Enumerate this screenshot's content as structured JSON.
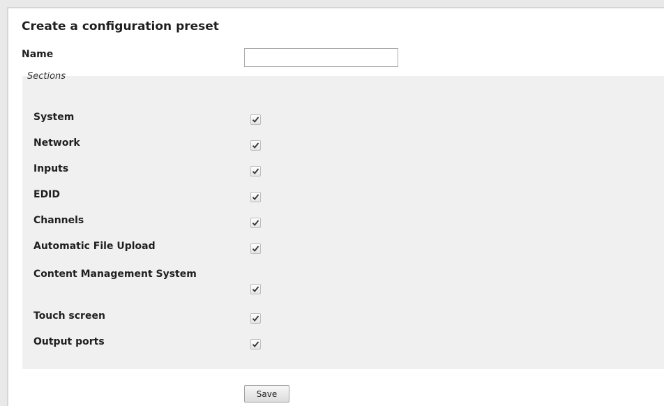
{
  "form": {
    "title": "Create a configuration preset",
    "name_label": "Name",
    "name_value": "",
    "sections_legend": "Sections",
    "sections": [
      {
        "label": "System",
        "checked": true
      },
      {
        "label": "Network",
        "checked": true
      },
      {
        "label": "Inputs",
        "checked": true
      },
      {
        "label": "EDID",
        "checked": true
      },
      {
        "label": "Channels",
        "checked": true
      },
      {
        "label": "Automatic File Upload",
        "checked": true
      },
      {
        "label": "Content Management System",
        "checked": true
      },
      {
        "label": "Touch screen",
        "checked": true
      },
      {
        "label": "Output ports",
        "checked": true
      }
    ],
    "save_label": "Save"
  },
  "icons": {
    "checkmark": "checkmark-icon"
  },
  "colors": {
    "page_bg": "#e9e9e9",
    "panel_bg": "#ffffff",
    "sections_bg": "#f0f0f0",
    "text": "#1f1f1f"
  }
}
